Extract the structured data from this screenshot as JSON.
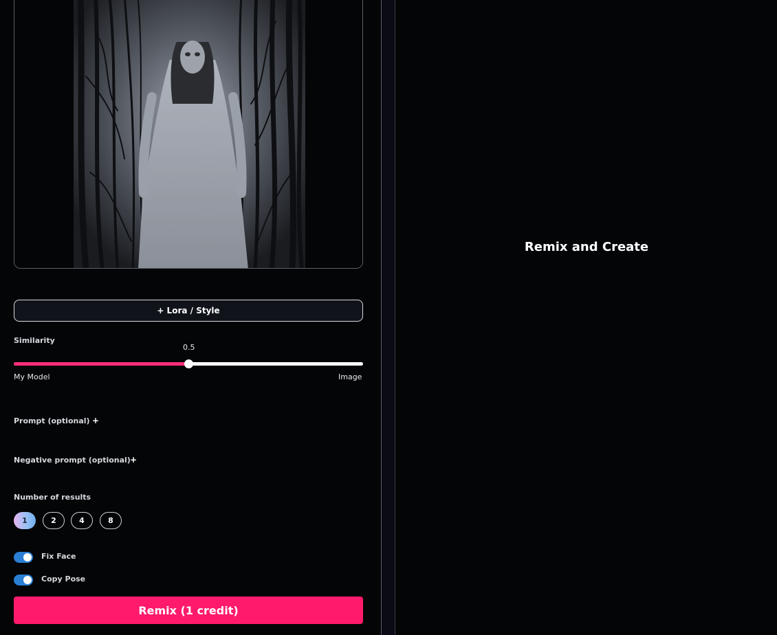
{
  "left": {
    "lora_button": "+ Lora / Style",
    "similarity": {
      "label": "Similarity",
      "value_text": "0.5",
      "value": 0.5,
      "min_label": "My Model",
      "max_label": "Image"
    },
    "prompt": {
      "label": "Prompt (optional)",
      "expand": "+"
    },
    "negative_prompt": {
      "label": "Negative prompt (optional)",
      "expand": "+"
    },
    "results": {
      "label": "Number of results",
      "options": [
        "1",
        "2",
        "4",
        "8"
      ],
      "selected": "1"
    },
    "toggles": {
      "fix_face": {
        "label": "Fix Face",
        "on": true
      },
      "copy_pose": {
        "label": "Copy Pose",
        "on": true
      }
    },
    "remix_button": "Remix (1 credit)"
  },
  "right": {
    "title": "Remix and Create"
  },
  "colors": {
    "accent": "#ff1a6c",
    "slider_fill": "#ff2e7a",
    "toggle": "#2a7fd4",
    "background": "#040507"
  }
}
